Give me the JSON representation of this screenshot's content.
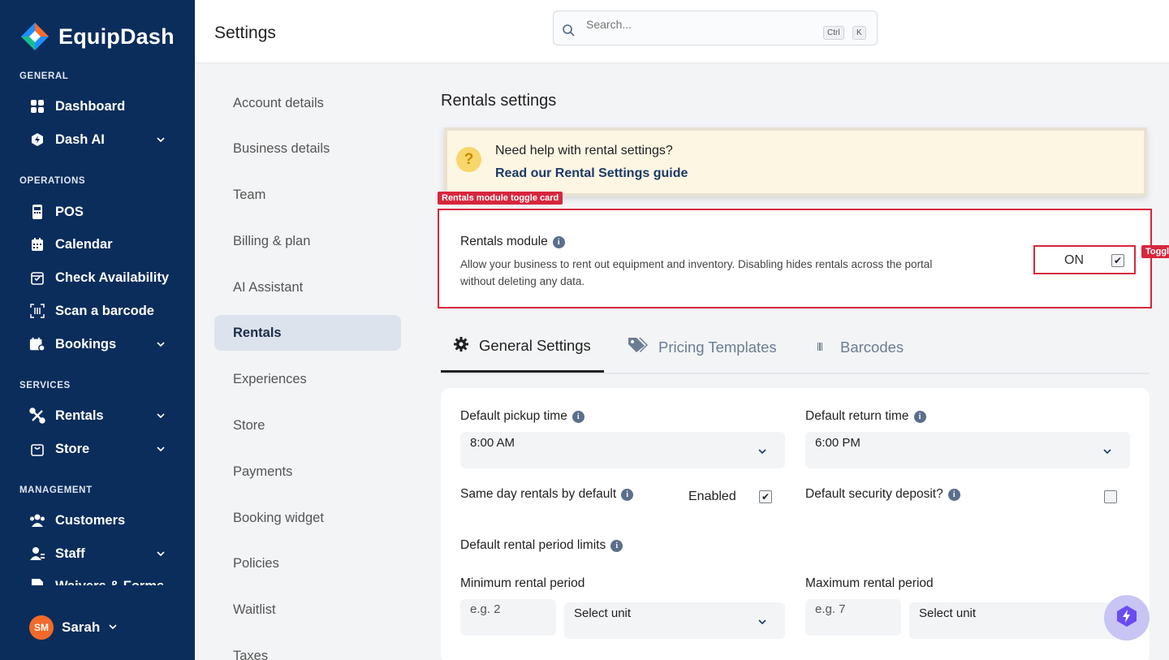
{
  "sidebar": {
    "brand": "EquipDash",
    "sections": {
      "general": "GENERAL",
      "operations": "OPERATIONS",
      "services": "SERVICES",
      "management": "MANAGEMENT"
    },
    "items": {
      "dashboard": "Dashboard",
      "dash_ai": "Dash AI",
      "pos": "POS",
      "calendar": "Calendar",
      "check_availability": "Check Availability",
      "scan_barcode": "Scan a barcode",
      "bookings": "Bookings",
      "rentals": "Rentals",
      "store": "Store",
      "customers": "Customers",
      "staff": "Staff",
      "waivers": "Waivers & Forms"
    },
    "user": {
      "initials": "SM",
      "name": "Sarah"
    }
  },
  "header": {
    "title": "Settings",
    "search_placeholder": "Search...",
    "shortcut_ctrl": "Ctrl",
    "shortcut_k": "K"
  },
  "settings_nav": {
    "items": [
      "Account details",
      "Business details",
      "Team",
      "Billing & plan",
      "AI Assistant",
      "Rentals",
      "Experiences",
      "Store",
      "Payments",
      "Booking widget",
      "Policies",
      "Waitlist",
      "Taxes"
    ],
    "active": "Rentals"
  },
  "main": {
    "title": "Rentals settings",
    "help": {
      "text": "Need help with rental settings?",
      "link": "Read our Rental Settings guide"
    },
    "annotation_card": "Rentals module toggle card",
    "annotation_toggle": "Toggl",
    "module": {
      "title": "Rentals module",
      "description": "Allow your business to rent out equipment and inventory. Disabling hides rentals across the portal without deleting any data.",
      "toggle_label": "ON",
      "toggle_checked": true
    },
    "tabs": {
      "general": "General Settings",
      "pricing": "Pricing Templates",
      "barcodes": "Barcodes"
    },
    "form": {
      "pickup_label": "Default pickup time",
      "pickup_value": "8:00 AM",
      "return_label": "Default return time",
      "return_value": "6:00 PM",
      "same_day_label": "Same day rentals by default",
      "same_day_status": "Enabled",
      "same_day_checked": true,
      "deposit_label": "Default security deposit?",
      "deposit_checked": false,
      "limits_label": "Default rental period limits",
      "min_label": "Minimum rental period",
      "min_placeholder": "e.g. 2",
      "min_unit": "Select unit",
      "max_label": "Maximum rental period",
      "max_placeholder": "e.g. 7",
      "max_unit": "Select unit"
    }
  },
  "colors": {
    "sidebar": "#0b2d5c",
    "accent_red": "#d7263d",
    "help_bg": "#fdf6e3",
    "fab": "#c8c4f4"
  }
}
